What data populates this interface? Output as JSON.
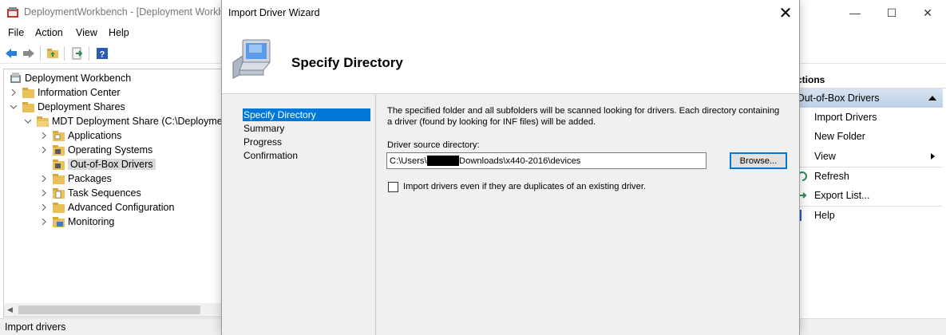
{
  "window": {
    "title": "DeploymentWorkbench - [Deployment Workbe",
    "minimize_glyph": "—",
    "maximize_glyph": "☐",
    "close_glyph": "✕"
  },
  "menu": [
    "File",
    "Action",
    "View",
    "Help"
  ],
  "toolbar": {
    "icons": [
      "back-icon",
      "forward-icon",
      "up-folder-icon",
      "export-icon",
      "help-icon"
    ]
  },
  "tree": {
    "root": "Deployment Workbench",
    "info_center": "Information Center",
    "deployment_shares": "Deployment Shares",
    "share": "MDT Deployment Share (C:\\Deploymen",
    "children": [
      "Applications",
      "Operating Systems",
      "Out-of-Box Drivers",
      "Packages",
      "Task Sequences",
      "Advanced Configuration",
      "Monitoring"
    ],
    "selected": "Out-of-Box Drivers"
  },
  "status": "Import drivers",
  "actions": {
    "header": "ctions",
    "section": "Out-of-Box Drivers",
    "items": [
      "Import Drivers",
      "New Folder",
      "View",
      "Refresh",
      "Export List...",
      "Help"
    ]
  },
  "wizard": {
    "title": "Import Driver Wizard",
    "close_glyph": "✕",
    "heading": "Specify Directory",
    "steps": [
      "Specify Directory",
      "Summary",
      "Progress",
      "Confirmation"
    ],
    "active_step": "Specify Directory",
    "description": "The specified folder and all subfolders will be scanned looking for drivers.  Each directory containing a driver (found by looking for INF files) will be added.",
    "source_label": "Driver source directory:",
    "source_value": "C:\\Users\\            \\Downloads\\x440-2016\\devices",
    "browse_label": "Browse...",
    "duplicates_label": "Import drivers even if they are duplicates of an existing driver.",
    "duplicates_checked": false
  },
  "colors": {
    "accent": "#0078d7",
    "folder": "#e8c15a",
    "section_bg": "#c9d9ec"
  }
}
